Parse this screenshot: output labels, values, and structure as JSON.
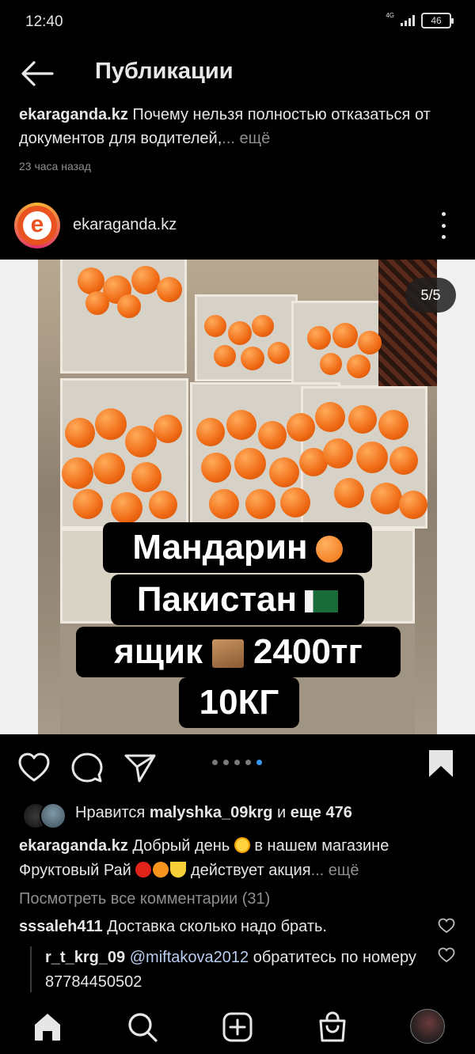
{
  "status_bar": {
    "time": "12:40",
    "network": "4G",
    "battery": "46"
  },
  "header": {
    "title": "Публикации"
  },
  "previous_post": {
    "username": "ekaraganda.kz",
    "caption": " Почему нельзя полностью отказаться от документов для водителей,",
    "more": "... ещё",
    "time": "23 часа назад"
  },
  "post": {
    "username": "ekaraganda.kz",
    "avatar_letter": "e",
    "image_counter": "5/5",
    "banner": {
      "line1": "Мандарин",
      "line2": "Пакистан",
      "line3_word": "ящик",
      "line3_price": "2400тг",
      "line4": "10КГ"
    },
    "carousel": {
      "count": 5,
      "active_index": 4
    },
    "likes": {
      "prefix": "Нравится ",
      "user": "malyshka_09krg",
      "middle": " и ",
      "others": "еще 476"
    },
    "caption": {
      "username": "ekaraganda.kz",
      "text1": " Добрый день ",
      "text2": "  в нашем магазине Фруктовый Рай ",
      "text3": " действует акция",
      "more": "... ещё"
    },
    "view_comments": "Посмотреть все комментарии (31)",
    "comments": [
      {
        "username": "sssaleh411",
        "text": " Доставка сколько надо брать."
      },
      {
        "username": "r_t_krg_09",
        "mention": "@miftakova2012",
        "text": " обратитесь по номеру 87784450502"
      }
    ]
  },
  "icons": {
    "back": "arrow-left-icon",
    "options": "more-vertical-icon",
    "like": "heart-icon",
    "comment": "comment-icon",
    "share": "send-icon",
    "save": "bookmark-icon",
    "home": "home-icon",
    "search": "search-icon",
    "create": "plus-square-icon",
    "shop": "shopping-bag-icon",
    "profile": "profile-avatar"
  },
  "colors": {
    "background": "#000000",
    "text": "#e6e6e6",
    "muted": "#8e8e8e",
    "accent": "#3897f0",
    "fruit": "#f06a14"
  }
}
